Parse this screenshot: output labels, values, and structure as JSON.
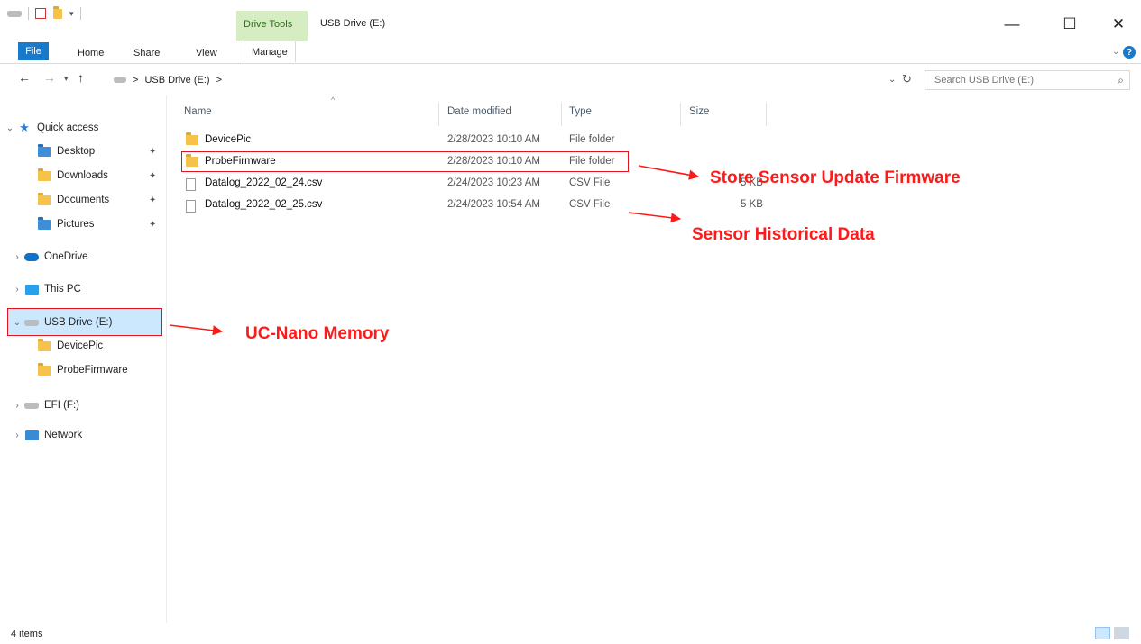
{
  "window": {
    "title": "USB Drive (E:)",
    "context_tab": "Drive Tools",
    "minimize_glyph": "—",
    "maximize_glyph": "☐",
    "close_glyph": "✕"
  },
  "ribbon": {
    "tabs": [
      "File",
      "Home",
      "Share",
      "View",
      "Manage"
    ],
    "help_glyph": "?"
  },
  "address": {
    "path": [
      "USB Drive (E:)"
    ],
    "separator": ">",
    "search_placeholder": "Search USB Drive (E:)"
  },
  "nav_pane": {
    "quick_access": "Quick access",
    "quick_items": [
      {
        "label": "Desktop",
        "icon": "folder-blue-icon"
      },
      {
        "label": "Downloads",
        "icon": "download-folder-icon"
      },
      {
        "label": "Documents",
        "icon": "documents-folder-icon"
      },
      {
        "label": "Pictures",
        "icon": "pictures-folder-icon"
      }
    ],
    "onedrive": "OneDrive",
    "this_pc": "This PC",
    "usb_drive": "USB Drive (E:)",
    "usb_children": [
      "DevicePic",
      "ProbeFirmware"
    ],
    "efi": "EFI (F:)",
    "network": "Network"
  },
  "columns": {
    "name": "Name",
    "date": "Date modified",
    "type": "Type",
    "size": "Size"
  },
  "files": [
    {
      "name": "DevicePic",
      "date": "2/28/2023 10:10 AM",
      "type": "File folder",
      "size": "",
      "kind": "folder"
    },
    {
      "name": "ProbeFirmware",
      "date": "2/28/2023 10:10 AM",
      "type": "File folder",
      "size": "",
      "kind": "folder"
    },
    {
      "name": "Datalog_2022_02_24.csv",
      "date": "2/24/2023 10:23 AM",
      "type": "CSV File",
      "size": "5 KB",
      "kind": "file"
    },
    {
      "name": "Datalog_2022_02_25.csv",
      "date": "2/24/2023 10:54 AM",
      "type": "CSV File",
      "size": "5 KB",
      "kind": "file"
    }
  ],
  "annotations": {
    "firmware": "Store Sensor Update Firmware",
    "historical": "Sensor Historical Data",
    "memory": "UC-Nano Memory",
    "color": "#ff1a1a"
  },
  "status": {
    "items": "4 items"
  },
  "colors": {
    "accent": "#1979ca",
    "selection": "#cce8ff",
    "drive_tools": "#d6ecc2",
    "highlight_border": "#e0141e"
  }
}
